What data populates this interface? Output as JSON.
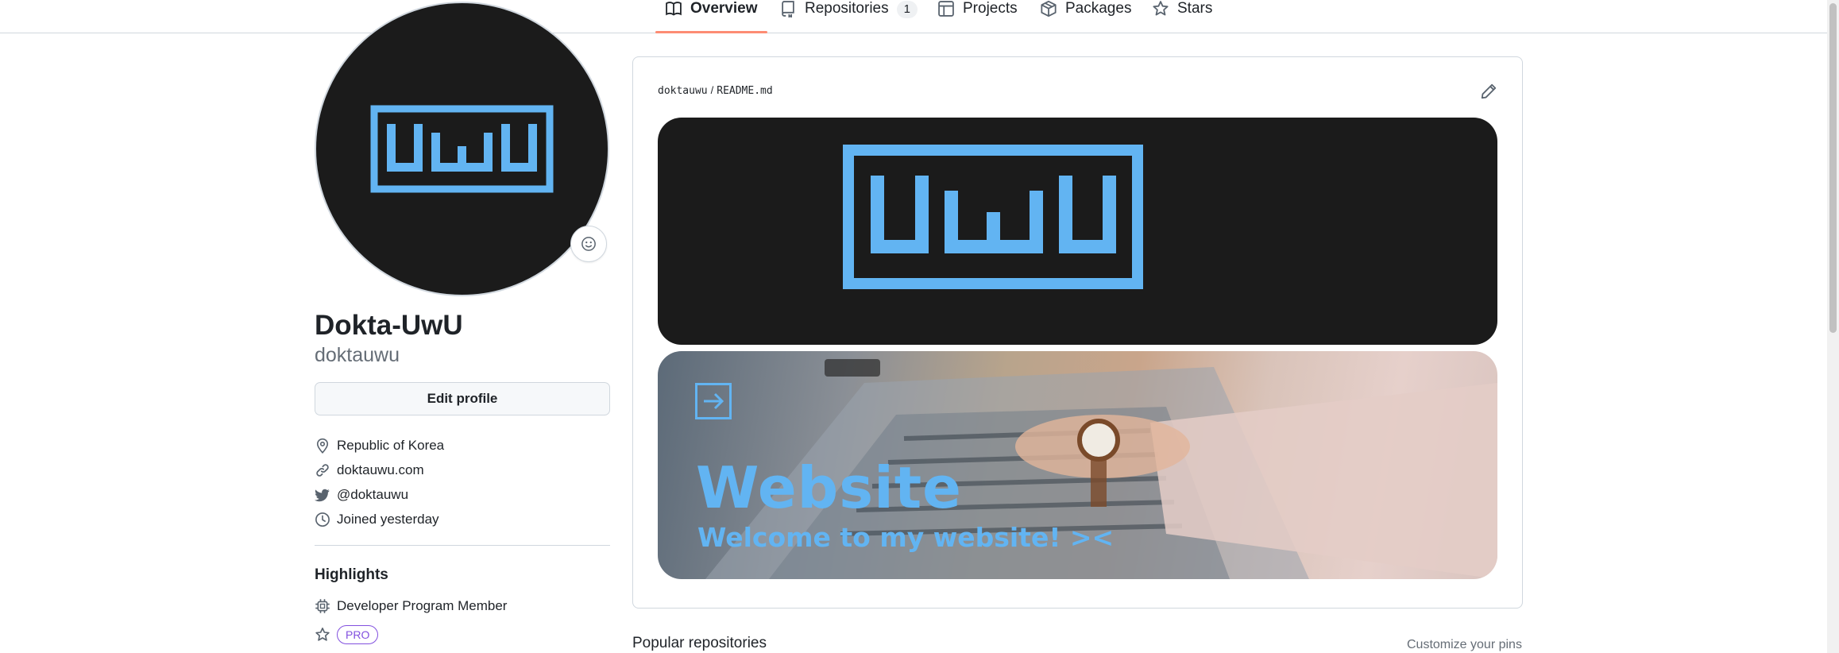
{
  "tabs": [
    {
      "label": "Overview",
      "icon": "book-icon",
      "active": true
    },
    {
      "label": "Repositories",
      "icon": "repo-icon",
      "count": "1"
    },
    {
      "label": "Projects",
      "icon": "table-icon"
    },
    {
      "label": "Packages",
      "icon": "package-icon"
    },
    {
      "label": "Stars",
      "icon": "star-icon"
    }
  ],
  "profile": {
    "avatar_text": "UwU",
    "name": "Dokta-UwU",
    "login": "doktauwu",
    "edit_label": "Edit profile",
    "details": [
      {
        "icon": "location-icon",
        "text": "Republic of Korea"
      },
      {
        "icon": "link-icon",
        "text": "doktauwu.com"
      },
      {
        "icon": "twitter-icon",
        "text": "@doktauwu"
      },
      {
        "icon": "clock-icon",
        "text": "Joined yesterday"
      }
    ],
    "highlights_title": "Highlights",
    "highlights": [
      {
        "icon": "cpu-icon",
        "text": "Developer Program Member"
      },
      {
        "icon": "star-icon",
        "badge": "PRO"
      }
    ]
  },
  "readme": {
    "owner": "doktauwu",
    "separator": "/",
    "file": "README.md",
    "banner_logo_text": "UwU",
    "website_title": "Website",
    "website_subtitle": "Welcome to my website! ><"
  },
  "popular": {
    "title": "Popular repositories",
    "customize_label": "Customize your pins"
  },
  "colors": {
    "accent_blue": "#62b4f2",
    "tab_underline": "#fd8c73",
    "pro_purple": "#8250df",
    "banner_dark": "#1b1b1b"
  }
}
